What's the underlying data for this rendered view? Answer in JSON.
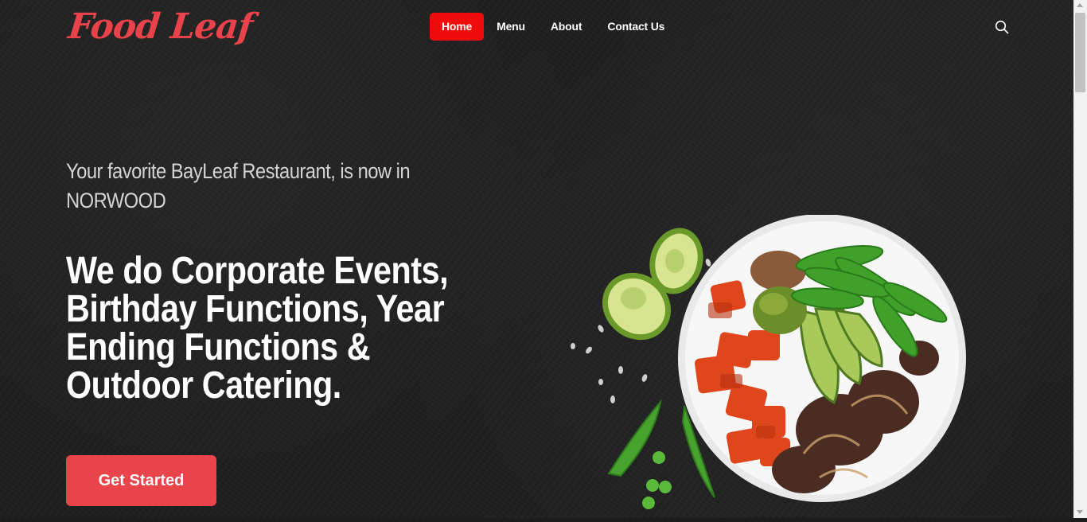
{
  "brand": {
    "logo_text": "Food Leaf",
    "color": "#e8424a"
  },
  "nav": {
    "items": [
      {
        "label": "Home",
        "active": true
      },
      {
        "label": "Menu",
        "active": false
      },
      {
        "label": "About",
        "active": false
      },
      {
        "label": "Contact Us",
        "active": false
      }
    ],
    "active_color": "#f10c0c",
    "search_icon": "search-icon"
  },
  "hero": {
    "tagline": "Your favorite BayLeaf Restaurant, is now in NORWOOD",
    "headline": "We do Corporate Events, Birthday Functions, Year Ending Functions & Outdoor Catering.",
    "cta_label": "Get Started",
    "cta_color": "#e8444a"
  }
}
